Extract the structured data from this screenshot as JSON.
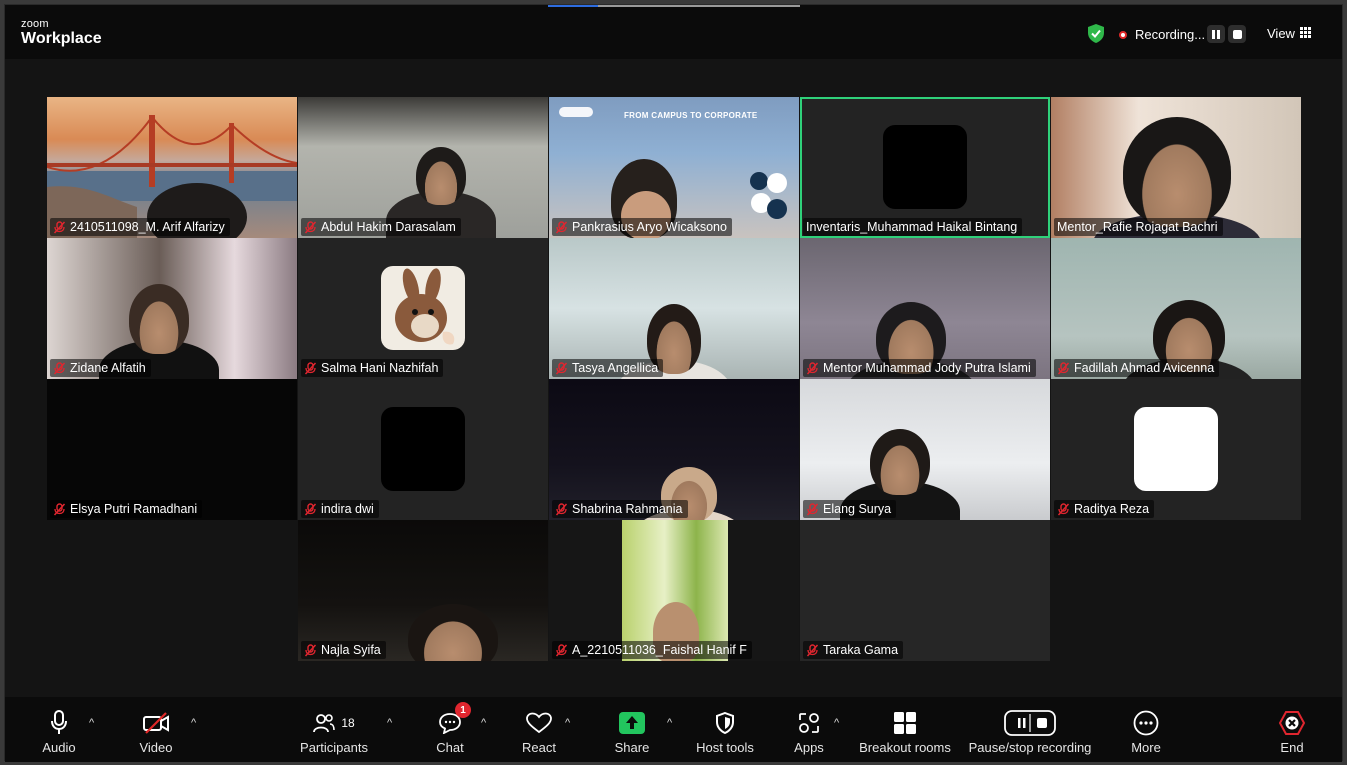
{
  "app": {
    "logo_top": "zoom",
    "logo_bottom": "Workplace"
  },
  "header": {
    "recording_label": "Recording...",
    "view_label": "View",
    "recording_color": "#e02828",
    "shield_color": "#2fb84a"
  },
  "participants": [
    {
      "name": "2410511098_M. Arif Alfarizy",
      "muted": true,
      "video": "bridge"
    },
    {
      "name": "Abdul Hakim Darasalam",
      "muted": true,
      "video": "person"
    },
    {
      "name": "Pankrasius Aryo Wicaksono",
      "muted": true,
      "video": "slide",
      "slide_title": "FROM CAMPUS TO CORPORATE"
    },
    {
      "name": "Inventaris_Muhammad Haikal Bintang",
      "muted": false,
      "video": "avatar-black",
      "active_speaker": true
    },
    {
      "name": "Mentor_Rafie Rojagat Bachri",
      "muted": false,
      "video": "person"
    },
    {
      "name": "Zidane Alfatih",
      "muted": true,
      "video": "person"
    },
    {
      "name": "Salma Hani Nazhifah",
      "muted": true,
      "video": "avatar-rabbit"
    },
    {
      "name": "Tasya Angellica",
      "muted": true,
      "video": "person"
    },
    {
      "name": "Mentor Muhammad Jody Putra Islami",
      "muted": true,
      "video": "person"
    },
    {
      "name": "Fadillah Ahmad Avicenna",
      "muted": true,
      "video": "person"
    },
    {
      "name": "Elsya Putri Ramadhani",
      "muted": true,
      "video": "off"
    },
    {
      "name": "indira dwi",
      "muted": true,
      "video": "avatar-black"
    },
    {
      "name": "Shabrina Rahmania",
      "muted": true,
      "video": "person"
    },
    {
      "name": "Elang Surya",
      "muted": true,
      "video": "person"
    },
    {
      "name": "Raditya Reza",
      "muted": true,
      "video": "avatar-white"
    },
    {
      "name": "Najla Syifa",
      "muted": true,
      "video": "person"
    },
    {
      "name": "A_2210511036_Faishal Hanif F",
      "muted": true,
      "video": "grass"
    },
    {
      "name": "Taraka Gama",
      "muted": true,
      "video": "off"
    }
  ],
  "toolbar": {
    "audio": "Audio",
    "video": "Video",
    "participants": "Participants",
    "participants_count": "18",
    "chat": "Chat",
    "chat_badge": "1",
    "react": "React",
    "share": "Share",
    "share_color": "#22c55e",
    "host_tools": "Host tools",
    "apps": "Apps",
    "breakout": "Breakout rooms",
    "recording": "Pause/stop recording",
    "more": "More",
    "end": "End",
    "end_color": "#e0262f"
  }
}
